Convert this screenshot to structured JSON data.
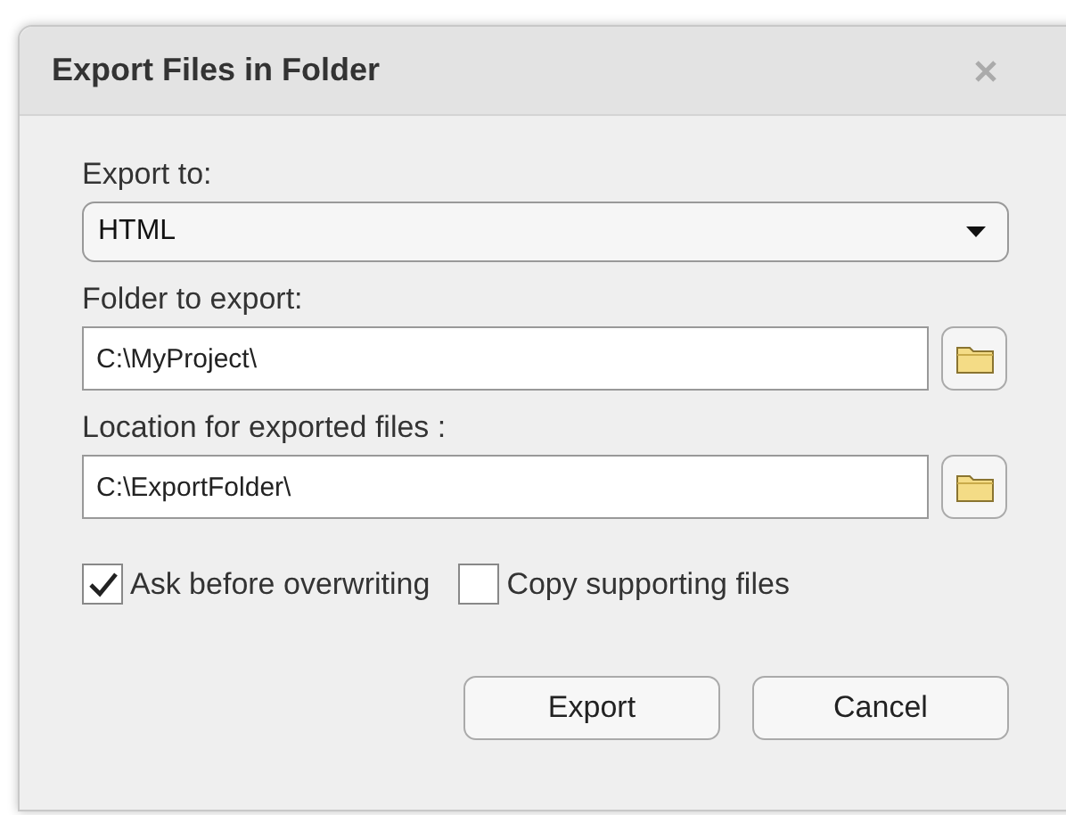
{
  "window": {
    "title": "Export Files in Folder"
  },
  "export_to": {
    "label": "Export to:",
    "value": "HTML"
  },
  "fields": [
    {
      "label": "Folder to export:",
      "value": "C:\\MyProject\\"
    },
    {
      "label": "Location for exported files :",
      "value": "C:\\ExportFolder\\"
    }
  ],
  "options": [
    {
      "label": "Ask before overwriting",
      "checked": true
    },
    {
      "label": "Copy supporting files",
      "checked": false
    }
  ],
  "buttons": [
    "Export",
    "Cancel"
  ]
}
